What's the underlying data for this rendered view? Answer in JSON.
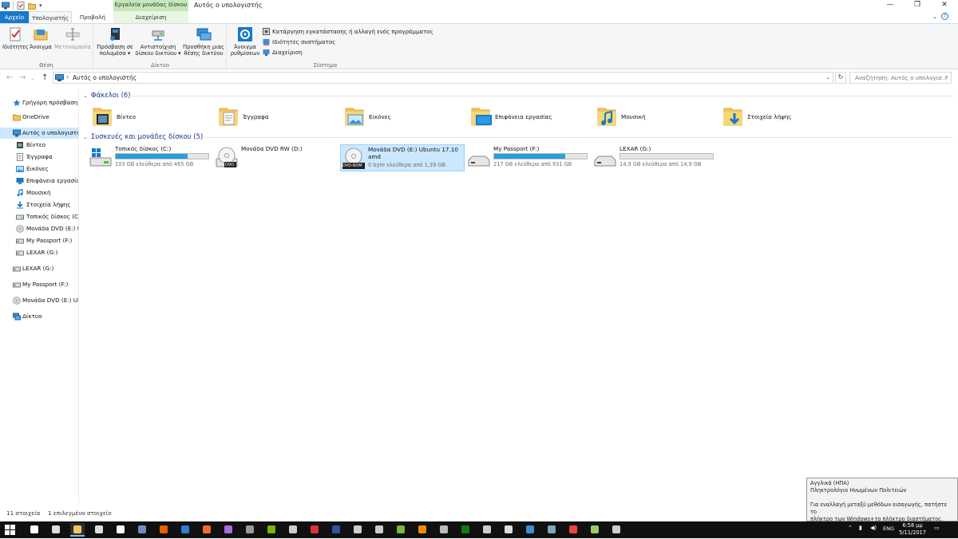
{
  "window": {
    "title": "Αυτός ο υπολογιστής",
    "context_tab_header": "Εργαλεία μονάδας δίσκου",
    "controls": {
      "minimize": "—",
      "maximize": "❐",
      "close": "✕"
    }
  },
  "tabs": {
    "file": "Αρχείο",
    "computer": "Υπολογιστής",
    "view": "Προβολή",
    "manage": "Διαχείριση",
    "help": "?"
  },
  "ribbon": {
    "location": {
      "label": "Θέση",
      "properties": "Ιδιότητες",
      "open": "Άνοιγμα",
      "rename": "Μετονομασία"
    },
    "network": {
      "label": "Δίκτυο",
      "access_media_1": "Πρόσβαση σε",
      "access_media_2": "πολυμέσα ▾",
      "map_drive_1": "Αντιστοίχιση",
      "map_drive_2": "δίσκου δικτύου ▾",
      "add_location_1": "Προσθήκη μιας",
      "add_location_2": "θέσης δικτύου"
    },
    "system": {
      "label": "Σύστημα",
      "open_settings_1": "Άνοιγμα",
      "open_settings_2": "ρυθμίσεων",
      "uninstall": "Κατάργηση εγκατάστασης ή αλλαγή ενός προγράμματος",
      "system_properties": "Ιδιότητες συστήματος",
      "manage": "Διαχείριση"
    }
  },
  "address": {
    "path": "Αυτός ο υπολογιστής",
    "search_placeholder": "Αναζήτηση: Αυτός ο υπολογισ..."
  },
  "nav_pane": [
    {
      "label": "Γρήγορη πρόσβαση",
      "icon": "star-icon",
      "indent": 0
    },
    {
      "label": "OneDrive",
      "icon": "cloud-folder-icon",
      "indent": 0
    },
    {
      "label": "Αυτός ο υπολογιστής",
      "icon": "computer-icon",
      "indent": 0,
      "selected": true
    },
    {
      "label": "Βίντεο",
      "icon": "video-folder-icon",
      "indent": 1
    },
    {
      "label": "Έγγραφα",
      "icon": "documents-folder-icon",
      "indent": 1
    },
    {
      "label": "Εικόνες",
      "icon": "pictures-folder-icon",
      "indent": 1
    },
    {
      "label": "Επιφάνεια εργασίας",
      "icon": "desktop-folder-icon",
      "indent": 1
    },
    {
      "label": "Μουσική",
      "icon": "music-folder-icon",
      "indent": 1
    },
    {
      "label": "Στοιχεία λήψης",
      "icon": "downloads-folder-icon",
      "indent": 1
    },
    {
      "label": "Τοπικός δίσκος (C:)",
      "icon": "hard-drive-icon",
      "indent": 1
    },
    {
      "label": "Μονάδα DVD (E:) U",
      "icon": "dvd-drive-icon",
      "indent": 1
    },
    {
      "label": "My Passport (F:)",
      "icon": "usb-drive-icon",
      "indent": 1
    },
    {
      "label": "LEXAR (G:)",
      "icon": "usb-drive-icon",
      "indent": 1
    },
    {
      "label": "LEXAR (G:)",
      "icon": "usb-drive-icon",
      "indent": 0
    },
    {
      "label": "My Passport (F:)",
      "icon": "usb-drive-icon",
      "indent": 0
    },
    {
      "label": "Μονάδα DVD (E:) Ubu",
      "icon": "dvd-drive-icon",
      "indent": 0
    },
    {
      "label": "Δίκτυο",
      "icon": "network-icon",
      "indent": 0
    }
  ],
  "folders_section": {
    "title": "Φάκελοι (6)"
  },
  "folders": [
    {
      "label": "Βίντεο",
      "icon": "video-folder-icon"
    },
    {
      "label": "Έγγραφα",
      "icon": "documents-folder-icon"
    },
    {
      "label": "Εικόνες",
      "icon": "pictures-folder-icon"
    },
    {
      "label": "Επιφάνεια εργασίας",
      "icon": "desktop-folder-icon"
    },
    {
      "label": "Μουσική",
      "icon": "music-folder-icon"
    },
    {
      "label": "Στοιχεία λήψης",
      "icon": "downloads-folder-icon"
    }
  ],
  "drives_section": {
    "title": "Συσκευές και μονάδες δίσκου (5)"
  },
  "drives": [
    {
      "name": "Τοπικός δίσκος (C:)",
      "space": "103 GB ελεύθερα από 465 GB",
      "used_fraction": 0.78,
      "icon": "windows-drive-icon"
    },
    {
      "name": "Μονάδα DVD RW (D:)",
      "space": "",
      "used_fraction": null,
      "icon": "dvd-drive-icon",
      "badge": "DVD"
    },
    {
      "name": "Μονάδα DVD (E:) Ubuntu 17.10",
      "name2": "amd",
      "space": "0 byte ελεύθερα από 1,39 GB",
      "used_fraction": null,
      "icon": "dvd-rom-icon",
      "badge": "DVD-ROM",
      "selected": true
    },
    {
      "name": "My Passport (F:)",
      "space": "217 GB ελεύθερα από 931 GB",
      "used_fraction": 0.77,
      "icon": "usb-drive-icon"
    },
    {
      "name": "LEXAR (G:)",
      "space": "14,9 GB ελεύθερα από 14,9 GB",
      "used_fraction": 0.0,
      "icon": "usb-drive-icon"
    }
  ],
  "status": {
    "count": "11 στοιχεία",
    "selected": "1 επιλεγμένο στοιχείο"
  },
  "ime_tooltip": {
    "line1": "Αγγλικά (ΗΠΑ)",
    "line2": "Πληκτρολόγιο Ηνωμένων Πολιτειών",
    "line3": "Για εναλλαγή μεταξύ μεθόδων εισαγωγής, πατήστε το",
    "line4": "πλήκτρο των Windows+το πλήκτρο διαστήματος."
  },
  "taskbar": {
    "lang": "ENG",
    "time": "6:58 μμ",
    "date": "5/11/2017",
    "apps": [
      "search-icon",
      "task-view-icon",
      "file-explorer-icon",
      "store-icon",
      "mail-icon",
      "steam-icon",
      "firefox-icon",
      "app-icon",
      "origin-icon",
      "app-icon",
      "epic-games-icon",
      "nvidia-icon",
      "app-icon",
      "app-icon",
      "app-icon",
      "word-icon",
      "app-icon",
      "utorrent-icon",
      "vlc-icon",
      "calculator-icon",
      "xbox-icon",
      "app-icon",
      "ssd-icon",
      "app-icon",
      "app-icon",
      "app-icon",
      "app-icon",
      "app-icon"
    ]
  },
  "colors": {
    "accent": "#1979ca",
    "bar_fill": "#26a0da",
    "selection": "#cce8ff",
    "section_header": "#1e3287",
    "folder": "#f2c55c",
    "taskbar": "#101010"
  }
}
